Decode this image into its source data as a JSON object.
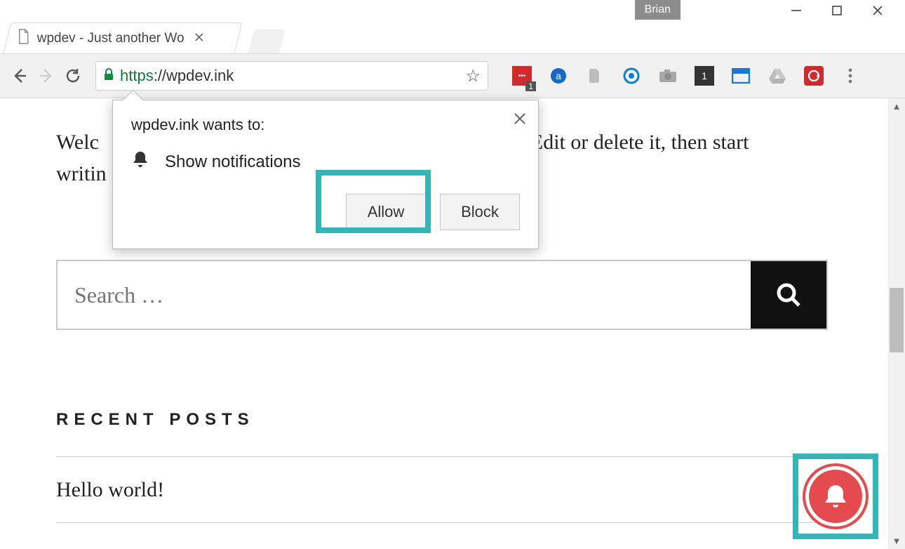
{
  "window": {
    "profile_name": "Brian"
  },
  "tab": {
    "title": "wpdev - Just another Wo"
  },
  "omnibox": {
    "scheme": "https",
    "host": "://wpdev.ink"
  },
  "extensions": {
    "lastpass_badge": "1",
    "onetab_badge": "1"
  },
  "notification_prompt": {
    "origin_text": "wpdev.ink wants to:",
    "permission_label": "Show notifications",
    "allow_label": "Allow",
    "block_label": "Block"
  },
  "page": {
    "intro_left": "Welc",
    "intro_right": "Edit or delete it, then start",
    "intro_line2": "writin",
    "search_placeholder": "Search …",
    "recent_posts_heading": "RECENT POSTS",
    "post_1_title": "Hello world!"
  }
}
